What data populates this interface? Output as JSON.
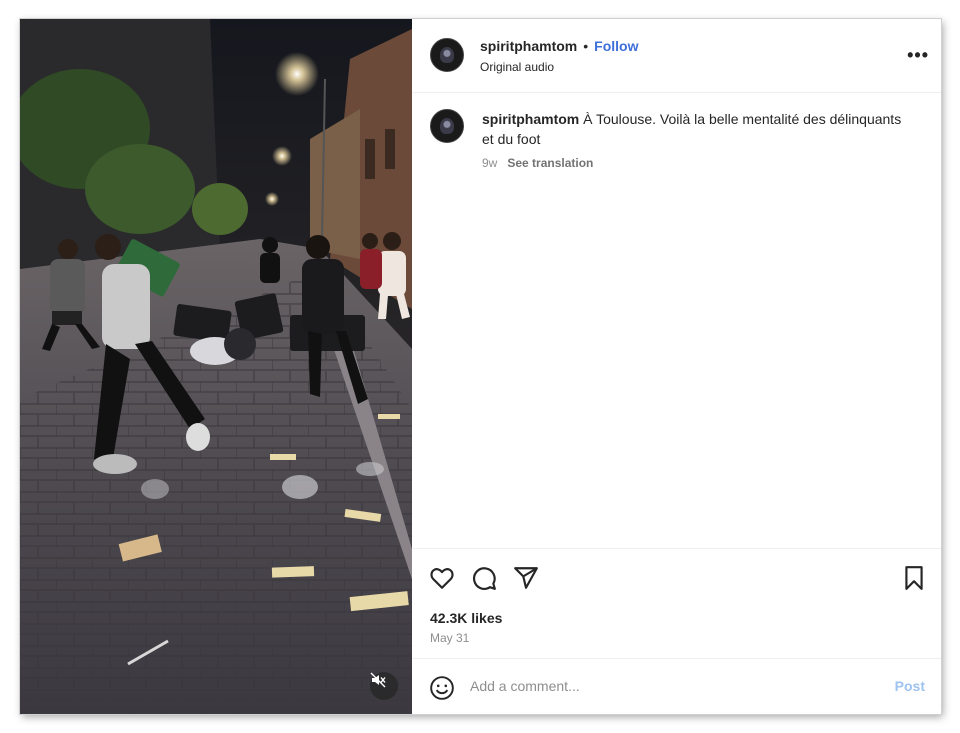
{
  "post": {
    "username": "spiritphamtom",
    "follow_label": "Follow",
    "separator": "•",
    "audio_label": "Original audio",
    "more_label": "•••"
  },
  "caption": {
    "username": "spiritphamtom",
    "text": "À Toulouse. Voilà la belle mentalité des délinquants et du foot",
    "age": "9w",
    "see_translation": "See translation"
  },
  "engagement": {
    "likes": "42.3K likes",
    "date": "May 31"
  },
  "comment": {
    "placeholder": "Add a comment...",
    "post_label": "Post"
  },
  "icons": {
    "like": "heart-icon",
    "comment": "comment-bubble-icon",
    "share": "paper-plane-icon",
    "save": "bookmark-icon",
    "emoji": "smiley-icon",
    "mute": "muted-speaker-icon"
  },
  "colors": {
    "follow": "#3d6fd9",
    "post_disabled": "#9ec3f0",
    "muted_text": "#8e8e8e"
  }
}
